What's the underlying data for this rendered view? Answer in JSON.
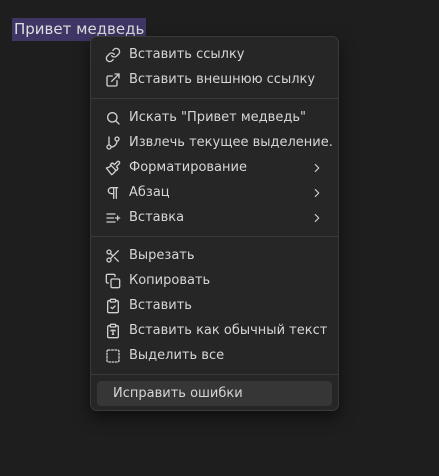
{
  "editor": {
    "selected_text": "Привет медведь"
  },
  "context_menu": {
    "groups": [
      [
        {
          "label": "Вставить ссылку",
          "icon": "link-icon"
        },
        {
          "label": "Вставить внешнюю ссылку",
          "icon": "external-link-icon"
        }
      ],
      [
        {
          "label": "Искать \"Привет медведь\"",
          "icon": "search-icon"
        },
        {
          "label": "Извлечь текущее выделение...",
          "icon": "git-branch-icon"
        },
        {
          "label": "Форматирование",
          "icon": "paintbrush-icon",
          "submenu": true
        },
        {
          "label": "Абзац",
          "icon": "pilcrow-icon",
          "submenu": true
        },
        {
          "label": "Вставка",
          "icon": "list-plus-icon",
          "submenu": true
        }
      ],
      [
        {
          "label": "Вырезать",
          "icon": "scissors-icon"
        },
        {
          "label": "Копировать",
          "icon": "copy-icon"
        },
        {
          "label": "Вставить",
          "icon": "clipboard-check-icon"
        },
        {
          "label": "Вставить как обычный текст",
          "icon": "clipboard-type-icon"
        },
        {
          "label": "Выделить все",
          "icon": "select-all-icon"
        }
      ]
    ],
    "footer_item": {
      "label": "Исправить ошибки",
      "highlighted": true
    }
  }
}
